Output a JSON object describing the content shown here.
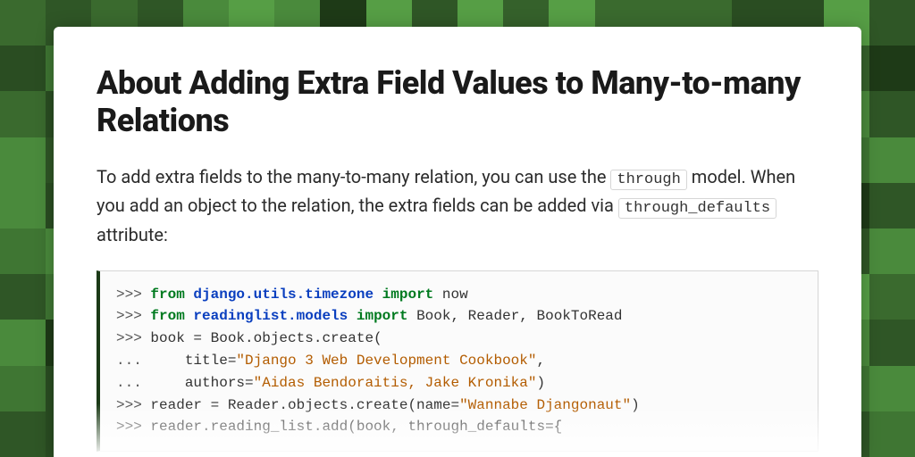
{
  "article": {
    "title": "About Adding Extra Field Values to Many-to-many Relations",
    "intro": {
      "part1": "To add extra fields to the many-to-many relation, you can use the ",
      "code1": "through",
      "part2": " model. When you add an object to the relation, the extra fields can be added via ",
      "code2": "through_defaults",
      "part3": " attribute:"
    }
  },
  "code": {
    "lines": [
      {
        "prompt": ">>> ",
        "tokens": [
          {
            "cls": "tok-kw",
            "t": "from"
          },
          {
            "cls": "tok-plain",
            "t": " "
          },
          {
            "cls": "tok-mod",
            "t": "django.utils.timezone"
          },
          {
            "cls": "tok-plain",
            "t": " "
          },
          {
            "cls": "tok-kw",
            "t": "import"
          },
          {
            "cls": "tok-plain",
            "t": " now"
          }
        ]
      },
      {
        "prompt": ">>> ",
        "tokens": [
          {
            "cls": "tok-kw",
            "t": "from"
          },
          {
            "cls": "tok-plain",
            "t": " "
          },
          {
            "cls": "tok-mod",
            "t": "readinglist.models"
          },
          {
            "cls": "tok-plain",
            "t": " "
          },
          {
            "cls": "tok-kw",
            "t": "import"
          },
          {
            "cls": "tok-plain",
            "t": " Book, Reader, BookToRead"
          }
        ]
      },
      {
        "prompt": ">>> ",
        "tokens": [
          {
            "cls": "tok-plain",
            "t": "book = Book.objects.create("
          }
        ]
      },
      {
        "prompt": "... ",
        "tokens": [
          {
            "cls": "tok-plain",
            "t": "    title="
          },
          {
            "cls": "tok-str",
            "t": "\"Django 3 Web Development Cookbook\""
          },
          {
            "cls": "tok-plain",
            "t": ","
          }
        ]
      },
      {
        "prompt": "... ",
        "tokens": [
          {
            "cls": "tok-plain",
            "t": "    authors="
          },
          {
            "cls": "tok-str",
            "t": "\"Aidas Bendoraitis, Jake Kronika\""
          },
          {
            "cls": "tok-plain",
            "t": ")"
          }
        ]
      },
      {
        "prompt": ">>> ",
        "tokens": [
          {
            "cls": "tok-plain",
            "t": "reader = Reader.objects.create(name="
          },
          {
            "cls": "tok-str",
            "t": "\"Wannabe Djangonaut\""
          },
          {
            "cls": "tok-plain",
            "t": ")"
          }
        ]
      },
      {
        "prompt": ">>> ",
        "tokens": [
          {
            "cls": "tok-plain",
            "t": "reader.reading_list.add(book, through_defaults={"
          }
        ]
      }
    ]
  },
  "bg": {
    "palette": [
      "#1e3a17",
      "#2a4d22",
      "#35612b",
      "#3f7633",
      "#4a8a3c",
      "#569e45",
      "#2f5626",
      "#3a6a2e"
    ]
  }
}
